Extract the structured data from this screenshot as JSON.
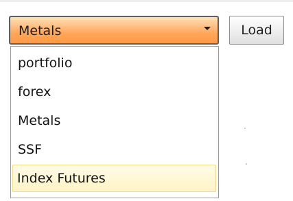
{
  "selector": {
    "selected_value": "Metals",
    "arrow_icon": "triangle-down-icon"
  },
  "load_button": {
    "label": "Load"
  },
  "dropdown": {
    "items": [
      {
        "label": "portfolio",
        "state": "normal"
      },
      {
        "label": "forex",
        "state": "normal"
      },
      {
        "label": "Metals",
        "state": "normal"
      },
      {
        "label": "SSF",
        "state": "normal"
      },
      {
        "label": "Index Futures",
        "state": "hovered"
      }
    ]
  },
  "colors": {
    "select_gradient_top": "#ffe2b7",
    "select_gradient_bottom": "#ff9a46",
    "hover_background": "#fff4c6",
    "hover_border": "#f3d98a"
  }
}
